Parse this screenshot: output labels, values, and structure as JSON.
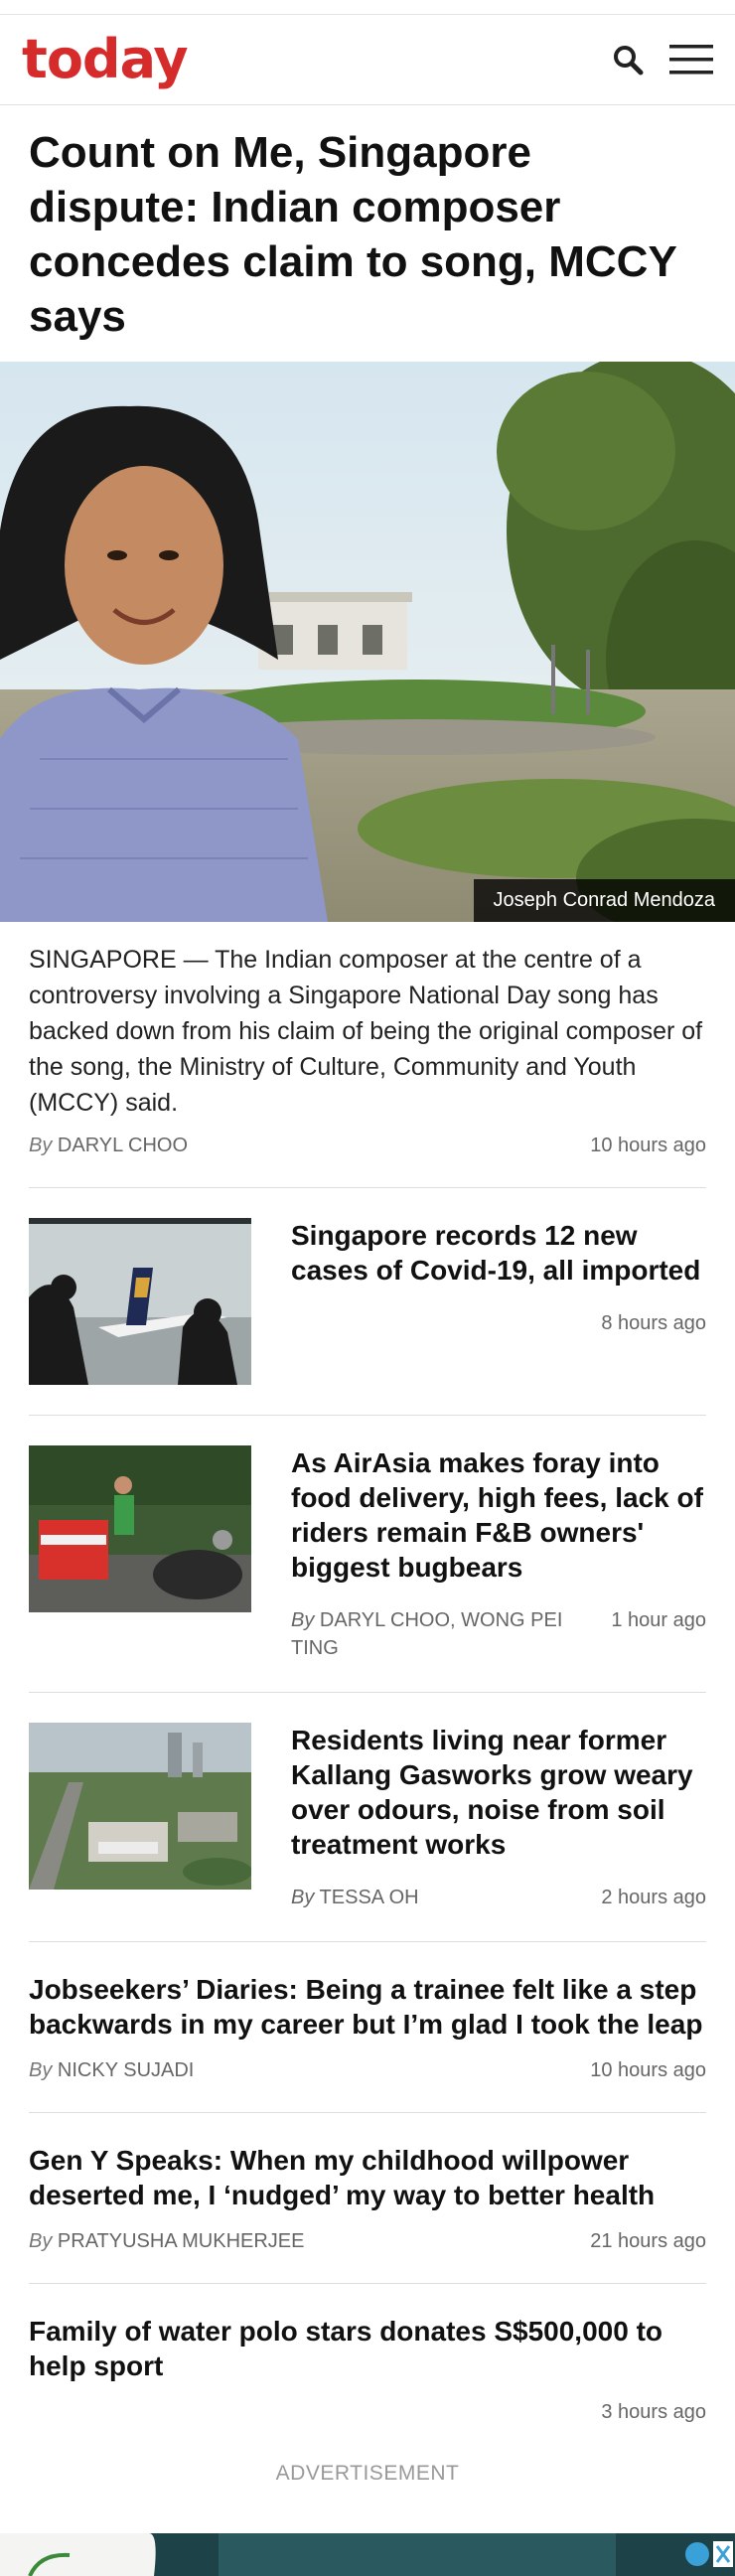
{
  "header": {
    "logo": "today",
    "search_icon": "search-icon",
    "menu_icon": "hamburger-menu-icon"
  },
  "article": {
    "headline": "Count on Me, Singapore dispute: Indian composer concedes claim to song, MCCY says",
    "photo_credit": "Joseph Conrad Mendoza",
    "lede": "SINGAPORE — The Indian composer at the centre of a controversy involving a Singapore National Day song has backed down from his claim of being the original composer of the song, the Ministry of Culture, Community and Youth (MCCY) said.",
    "by": "By",
    "author": "DARYL CHOO",
    "time": "10 hours ago"
  },
  "stories": [
    {
      "title": "Singapore records 12 new cases of Covid-19, all imported",
      "by": "",
      "author": "",
      "time": "8 hours ago"
    },
    {
      "title": "As AirAsia makes foray into food delivery, high fees, lack of riders remain F&B owners' biggest bugbears",
      "by": "By",
      "author": "DARYL CHOO, WONG PEI TING",
      "time": "1 hour ago"
    },
    {
      "title": "Residents living near former Kallang Gasworks grow weary over odours, noise from soil treatment works",
      "by": "By",
      "author": "TESSA OH",
      "time": "2 hours ago"
    }
  ],
  "wide_stories": [
    {
      "title": "Jobseekers’ Diaries: Being a trainee felt like a step backwards in my career but I’m glad I took the leap",
      "by": "By",
      "author": "NICKY SUJADI",
      "time": "10 hours ago"
    },
    {
      "title": "Gen Y Speaks: When my childhood willpower deserted me, I ‘nudged’ my way to better health",
      "by": "By",
      "author": "PRATYUSHA MUKHERJEE",
      "time": "21 hours ago"
    },
    {
      "title": "Family of water polo stars donates S$500,000 to help sport",
      "by": "",
      "author": "",
      "time": "3 hours ago"
    }
  ],
  "advertisement_label": "ADVERTISEMENT",
  "colors": {
    "brand": "#d62b2b"
  }
}
